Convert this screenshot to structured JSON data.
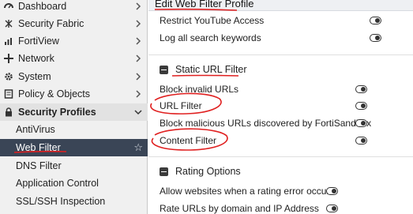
{
  "sidebar": {
    "items": [
      {
        "label": "Dashboard",
        "icon": "dashboard-icon"
      },
      {
        "label": "Security Fabric",
        "icon": "security-fabric-icon"
      },
      {
        "label": "FortiView",
        "icon": "fortiview-icon"
      },
      {
        "label": "Network",
        "icon": "network-icon"
      },
      {
        "label": "System",
        "icon": "gear-icon"
      },
      {
        "label": "Policy & Objects",
        "icon": "policy-icon"
      },
      {
        "label": "Security Profiles",
        "icon": "lock-icon"
      }
    ],
    "subitems": [
      {
        "label": "AntiVirus"
      },
      {
        "label": "Web Filter",
        "active": true
      },
      {
        "label": "DNS Filter"
      },
      {
        "label": "Application Control"
      },
      {
        "label": "SSL/SSH Inspection"
      }
    ]
  },
  "main": {
    "title": "Edit Web Filter Profile",
    "top_rows": [
      {
        "label": "Restrict YouTube Access"
      },
      {
        "label": "Log all search keywords"
      }
    ],
    "static_url": {
      "header": "Static URL Filter",
      "rows": [
        {
          "label": "Block invalid URLs"
        },
        {
          "label": "URL Filter"
        },
        {
          "label": "Block malicious URLs discovered by FortiSandbox"
        },
        {
          "label": "Content Filter"
        }
      ]
    },
    "rating": {
      "header": "Rating Options",
      "rows": [
        {
          "label": "Allow websites when a rating error occurs"
        },
        {
          "label": "Rate URLs by domain and IP Address"
        }
      ]
    }
  },
  "colors": {
    "active_bg": "#3a4556",
    "annotation": "#e02020"
  }
}
